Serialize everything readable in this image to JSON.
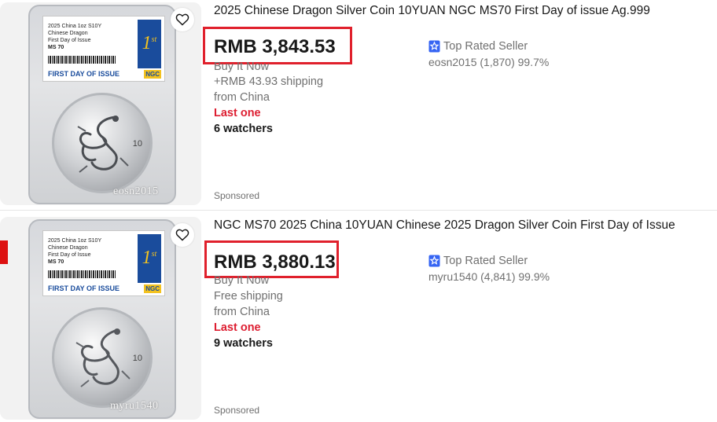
{
  "listings": [
    {
      "title": "2025 Chinese Dragon Silver Coin 10YUAN NGC MS70 First Day of issue Ag.999",
      "price": "RMB 3,843.53",
      "format": "Buy It Now",
      "shipping": "+RMB 43.93 shipping",
      "location": "from China",
      "stock": "Last one",
      "watchers": "6 watchers",
      "seller_badge": "Top Rated Seller",
      "seller_info": "eosn2015 (1,870) 99.7%",
      "sponsored": "Sponsored",
      "image_watermark": "eosn2015",
      "slab_label": [
        "2025 China 1oz S10Y",
        "Chinese Dragon",
        "First Day of Issue",
        "MS 70"
      ],
      "slab_banner": "FIRST DAY OF ISSUE",
      "slab_first": "1",
      "slab_first_suffix": "st",
      "slab_grader": "NGC",
      "coin_denomination": "10"
    },
    {
      "title": "NGC MS70 2025 China 10YUAN Chinese 2025 Dragon Silver Coin First Day of Issue",
      "price": "RMB 3,880.13",
      "format": "Buy It Now",
      "shipping": "Free shipping",
      "location": "from China",
      "stock": "Last one",
      "watchers": "9 watchers",
      "seller_badge": "Top Rated Seller",
      "seller_info": "myru1540 (4,841) 99.9%",
      "sponsored": "Sponsored",
      "image_watermark": "myru1540",
      "slab_label": [
        "2025 China 1oz S10Y",
        "Chinese Dragon",
        "First Day of Issue",
        "MS 70"
      ],
      "slab_banner": "FIRST DAY OF ISSUE",
      "slab_first": "1",
      "slab_first_suffix": "st",
      "slab_grader": "NGC",
      "coin_denomination": "10"
    }
  ],
  "colors": {
    "highlight_box": "#e0202c",
    "last_one": "#dd1e31",
    "badge_blue": "#3665f3",
    "muted_text": "#707070"
  },
  "icons": {
    "favorite": "heart-outline-icon",
    "seller_badge": "star-badge-icon"
  }
}
